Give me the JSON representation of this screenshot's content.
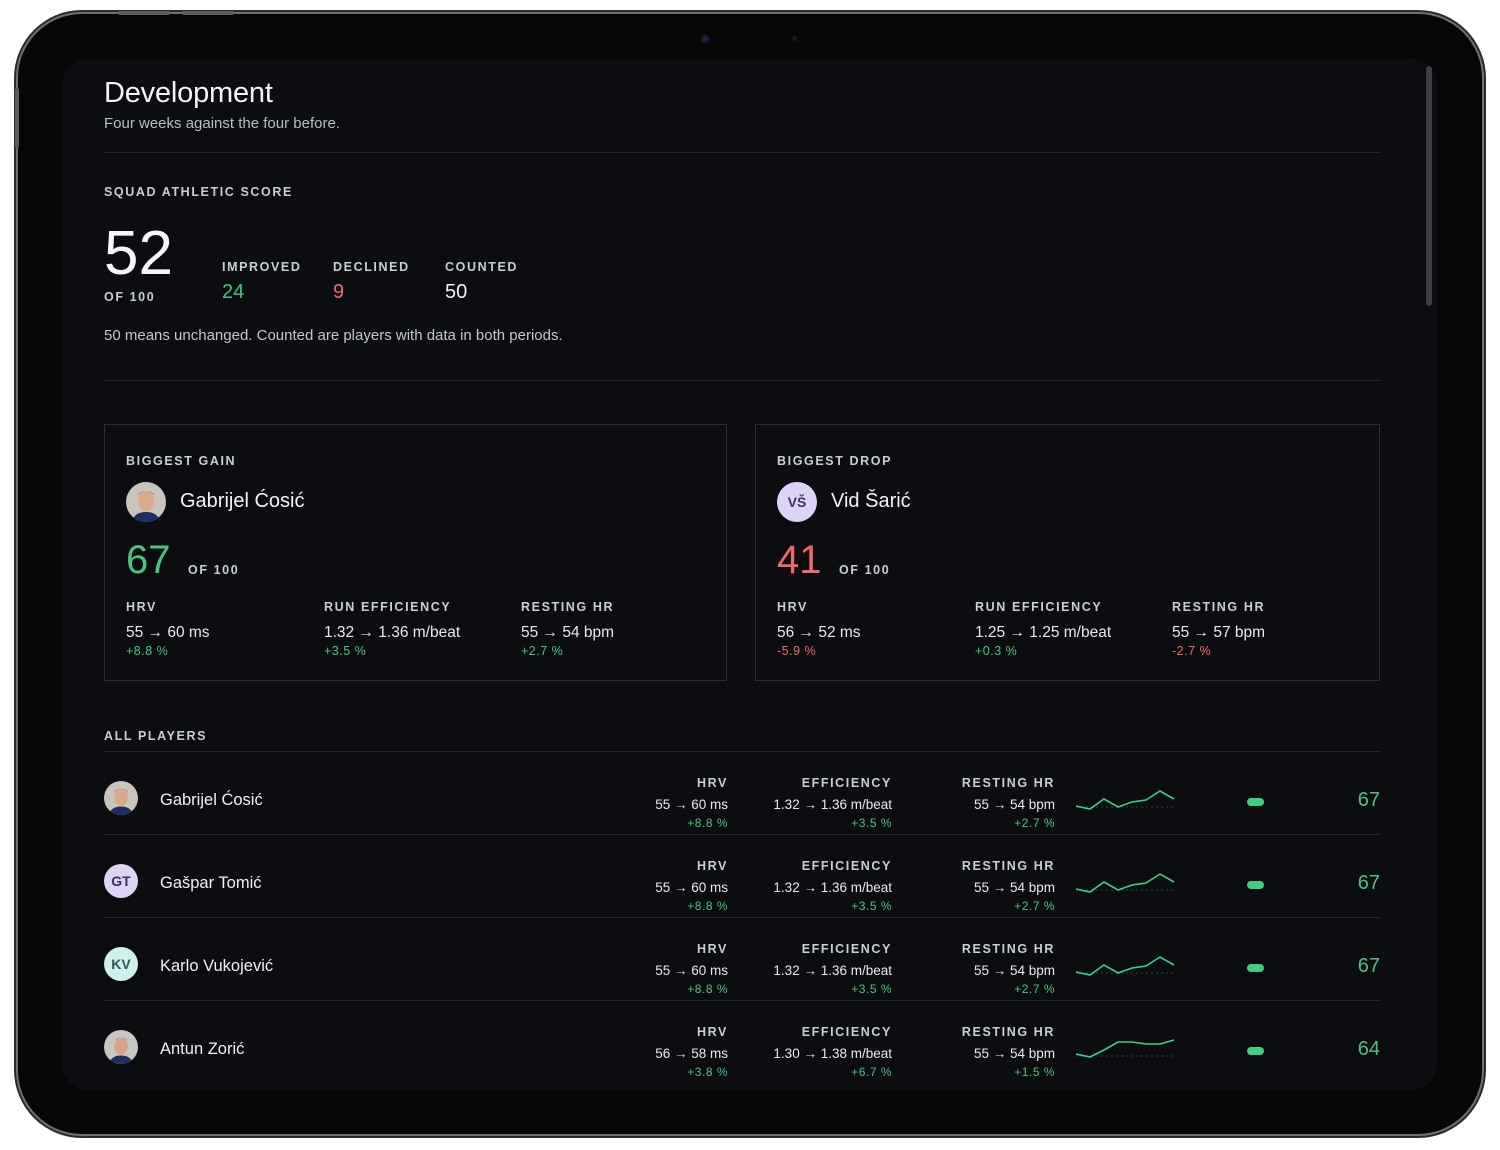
{
  "header": {
    "title": "Development",
    "subtitle": "Four weeks against the four before."
  },
  "squad": {
    "label": "SQUAD ATHLETIC SCORE",
    "score": "52",
    "of": "OF 100",
    "improved_label": "IMPROVED",
    "improved": "24",
    "declined_label": "DECLINED",
    "declined": "9",
    "counted_label": "COUNTED",
    "counted": "50",
    "note": "50 means unchanged. Counted are players with data in both periods."
  },
  "gain": {
    "label": "BIGGEST GAIN",
    "name": "Gabrijel Ćosić",
    "score": "67",
    "of": "OF 100",
    "metrics": [
      {
        "label": "HRV",
        "value": "55 → 60 ms",
        "change": "+8.8 %"
      },
      {
        "label": "RUN EFFICIENCY",
        "value": "1.32 → 1.36 m/beat",
        "change": "+3.5 %"
      },
      {
        "label": "RESTING HR",
        "value": "55 → 54 bpm",
        "change": "+2.7 %"
      }
    ]
  },
  "drop": {
    "label": "BIGGEST DROP",
    "initials": "VŠ",
    "name": "Vid Šarić",
    "score": "41",
    "of": "OF 100",
    "metrics": [
      {
        "label": "HRV",
        "value": "56 → 52 ms",
        "change": "-5.9 %"
      },
      {
        "label": "RUN EFFICIENCY",
        "value": "1.25 → 1.25 m/beat",
        "change": "+0.3 %"
      },
      {
        "label": "RESTING HR",
        "value": "55 → 57 bpm",
        "change": "-2.7 %"
      }
    ]
  },
  "players_label": "ALL PLAYERS",
  "players": [
    {
      "name": "Gabrijel Ćosić",
      "initials": "",
      "hrv_label": "HRV",
      "hrv": "55 → 60 ms",
      "hrv_change": "+8.8 %",
      "eff_label": "EFFICIENCY",
      "eff": "1.32 → 1.36 m/beat",
      "eff_change": "+3.5 %",
      "rhr_label": "RESTING HR",
      "rhr": "55 → 54 bpm",
      "rhr_change": "+2.7 %",
      "score": "67"
    },
    {
      "name": "Gašpar Tomić",
      "initials": "GT",
      "hrv_label": "HRV",
      "hrv": "55 → 60 ms",
      "hrv_change": "+8.8 %",
      "eff_label": "EFFICIENCY",
      "eff": "1.32 → 1.36 m/beat",
      "eff_change": "+3.5 %",
      "rhr_label": "RESTING HR",
      "rhr": "55 → 54 bpm",
      "rhr_change": "+2.7 %",
      "score": "67"
    },
    {
      "name": "Karlo Vukojević",
      "initials": "KV",
      "hrv_label": "HRV",
      "hrv": "55 → 60 ms",
      "hrv_change": "+8.8 %",
      "eff_label": "EFFICIENCY",
      "eff": "1.32 → 1.36 m/beat",
      "eff_change": "+3.5 %",
      "rhr_label": "RESTING HR",
      "rhr": "55 → 54 bpm",
      "rhr_change": "+2.7 %",
      "score": "67"
    },
    {
      "name": "Antun Zorić",
      "initials": "",
      "hrv_label": "HRV",
      "hrv": "56 → 58 ms",
      "hrv_change": "+3.8 %",
      "eff_label": "EFFICIENCY",
      "eff": "1.30 → 1.38 m/beat",
      "eff_change": "+6.7 %",
      "rhr_label": "RESTING HR",
      "rhr": "55 → 54 bpm",
      "rhr_change": "+1.5 %",
      "score": "64"
    }
  ],
  "colors": {
    "positive": "#4cc47e",
    "negative": "#ee6a6a",
    "background": "#0b0d10"
  }
}
